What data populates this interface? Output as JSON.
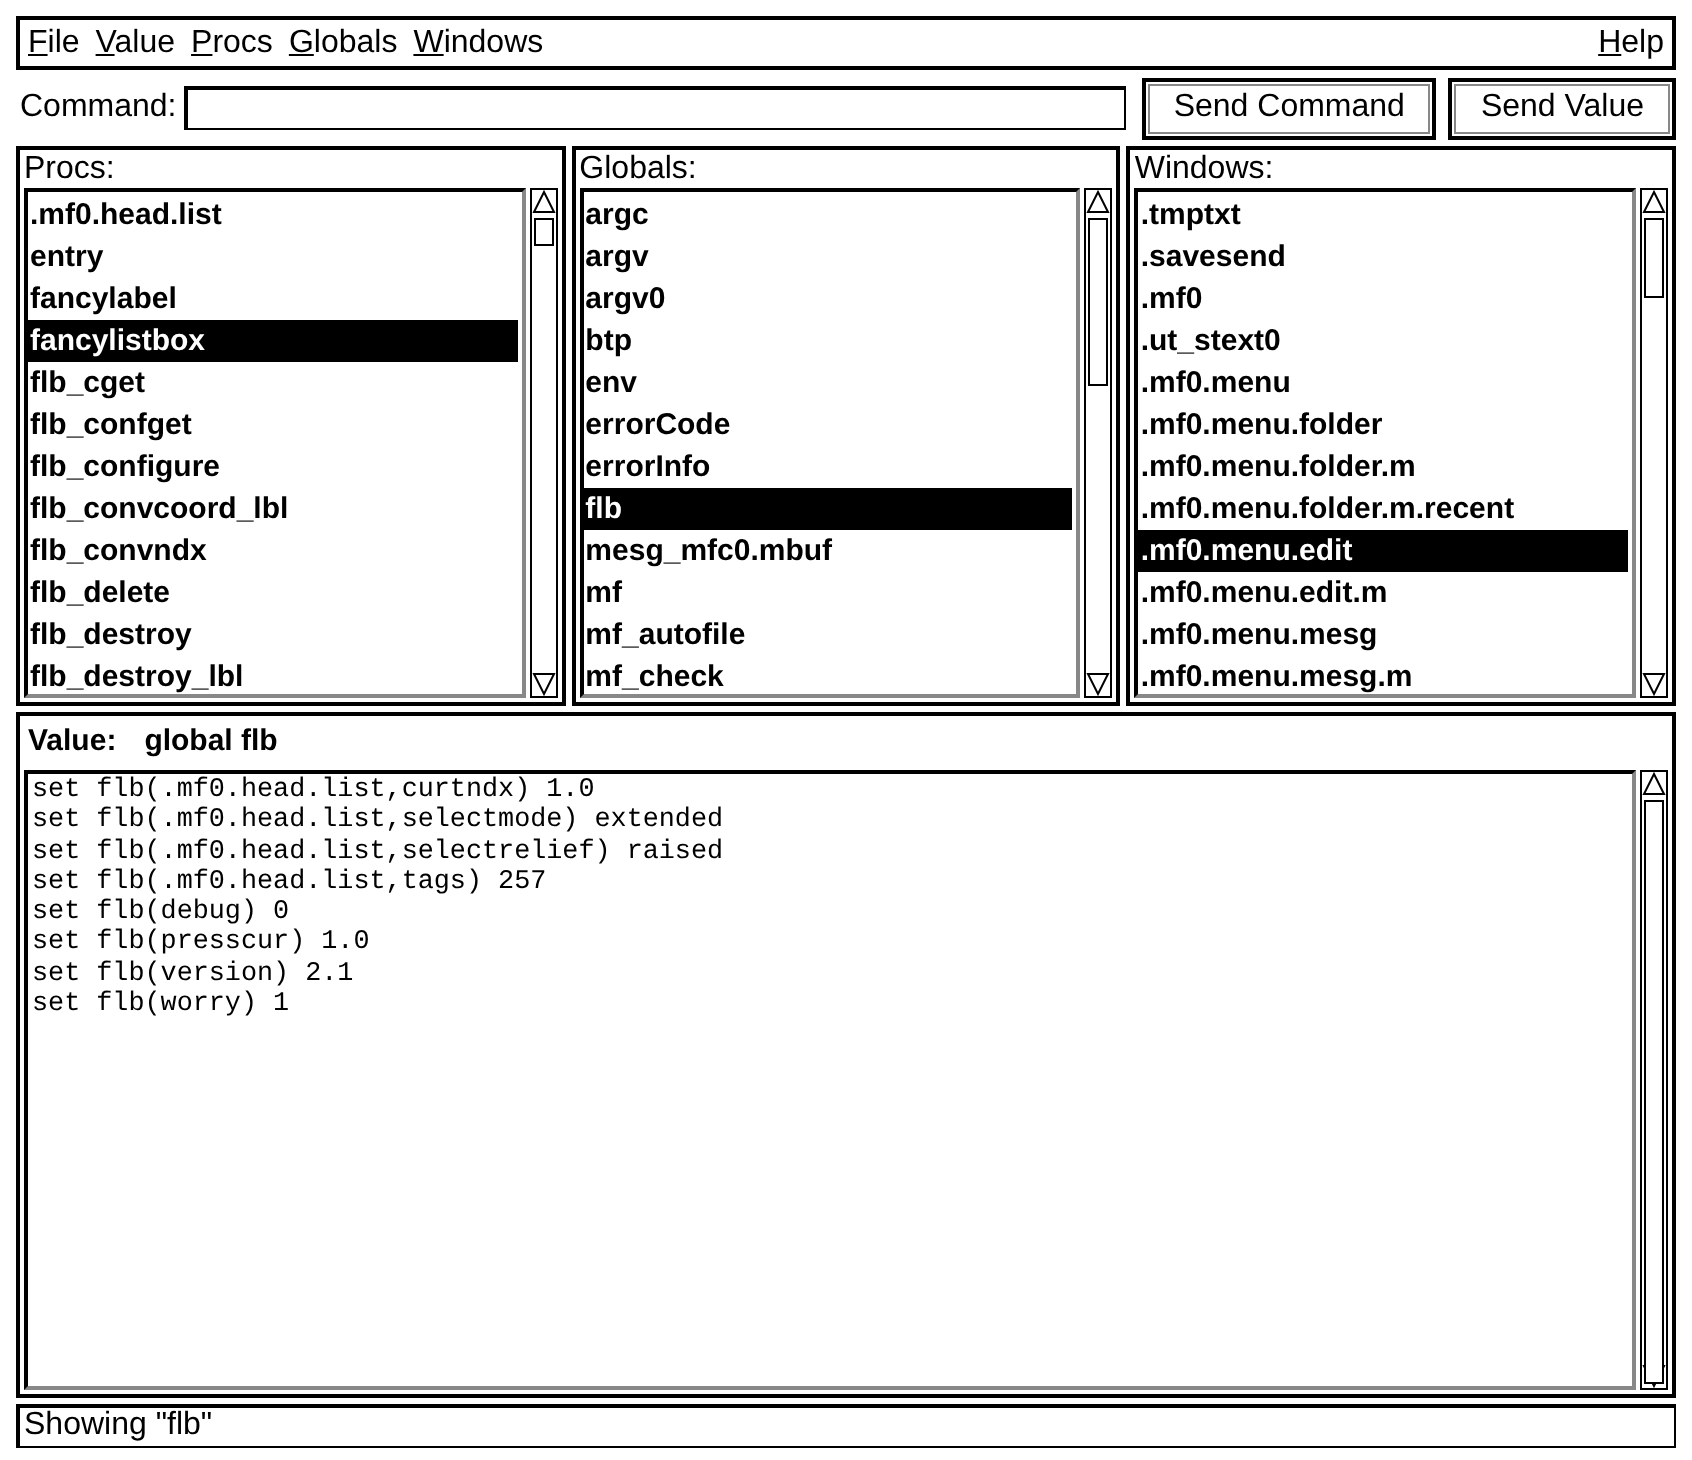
{
  "menu_bar": {
    "left": [
      {
        "label": "File"
      },
      {
        "label": "Value"
      },
      {
        "label": "Procs"
      },
      {
        "label": "Globals"
      },
      {
        "label": "Windows"
      }
    ],
    "right": [
      {
        "label": "Help"
      }
    ]
  },
  "command": {
    "label": "Command:"
  },
  "buttons": [
    "Send Command",
    "Send Value"
  ],
  "panes": [
    {
      "title": "Procs:",
      "items": [
        {
          "label": ".mf0.head.list",
          "selected": false
        },
        {
          "label": "entry",
          "selected": false
        },
        {
          "label": "fancylabel",
          "selected": false
        },
        {
          "label": "fancylistbox",
          "selected": true
        },
        {
          "label": "flb_cget",
          "selected": false
        },
        {
          "label": "flb_confget",
          "selected": false
        },
        {
          "label": "flb_configure",
          "selected": false
        },
        {
          "label": "flb_convcoord_lbl",
          "selected": false
        },
        {
          "label": "flb_convndx",
          "selected": false
        },
        {
          "label": "flb_delete",
          "selected": false
        },
        {
          "label": "flb_destroy",
          "selected": false
        },
        {
          "label": "flb_destroy_lbl",
          "selected": false
        }
      ]
    },
    {
      "title": "Globals:",
      "items": [
        {
          "label": "argc",
          "selected": false
        },
        {
          "label": "argv",
          "selected": false
        },
        {
          "label": "argv0",
          "selected": false
        },
        {
          "label": "btp",
          "selected": false
        },
        {
          "label": "env",
          "selected": false
        },
        {
          "label": "errorCode",
          "selected": false
        },
        {
          "label": "errorInfo",
          "selected": false
        },
        {
          "label": "flb",
          "selected": true
        },
        {
          "label": "mesg_mfc0.mbuf",
          "selected": false
        },
        {
          "label": "mf",
          "selected": false
        },
        {
          "label": "mf_autofile",
          "selected": false
        },
        {
          "label": "mf_check",
          "selected": false
        }
      ]
    },
    {
      "title": "Windows:",
      "items": [
        {
          "label": ".tmptxt",
          "selected": false
        },
        {
          "label": ".savesend",
          "selected": false
        },
        {
          "label": ".mf0",
          "selected": false
        },
        {
          "label": ".ut_stext0",
          "selected": false
        },
        {
          "label": ".mf0.menu",
          "selected": false
        },
        {
          "label": ".mf0.menu.folder",
          "selected": false
        },
        {
          "label": ".mf0.menu.folder.m",
          "selected": false
        },
        {
          "label": ".mf0.menu.folder.m.recent",
          "selected": false
        },
        {
          "label": ".mf0.menu.edit",
          "selected": true
        },
        {
          "label": ".mf0.menu.edit.m",
          "selected": false
        },
        {
          "label": ".mf0.menu.mesg",
          "selected": false
        },
        {
          "label": ".mf0.menu.mesg.m",
          "selected": false
        }
      ]
    }
  ],
  "value": {
    "label": "Value:",
    "name": "global flb",
    "lines": [
      "set flb(.mf0.head.list,curtndx) 1.0",
      "set flb(.mf0.head.list,selectmode) extended",
      "set flb(.mf0.head.list,selectrelief) raised",
      "set flb(.mf0.head.list,tags) 257",
      "set flb(debug) 0",
      "set flb(presscur) 1.0",
      "set flb(version) 2.1",
      "set flb(worry) 1"
    ]
  },
  "status_bar": "Showing \"flb\""
}
